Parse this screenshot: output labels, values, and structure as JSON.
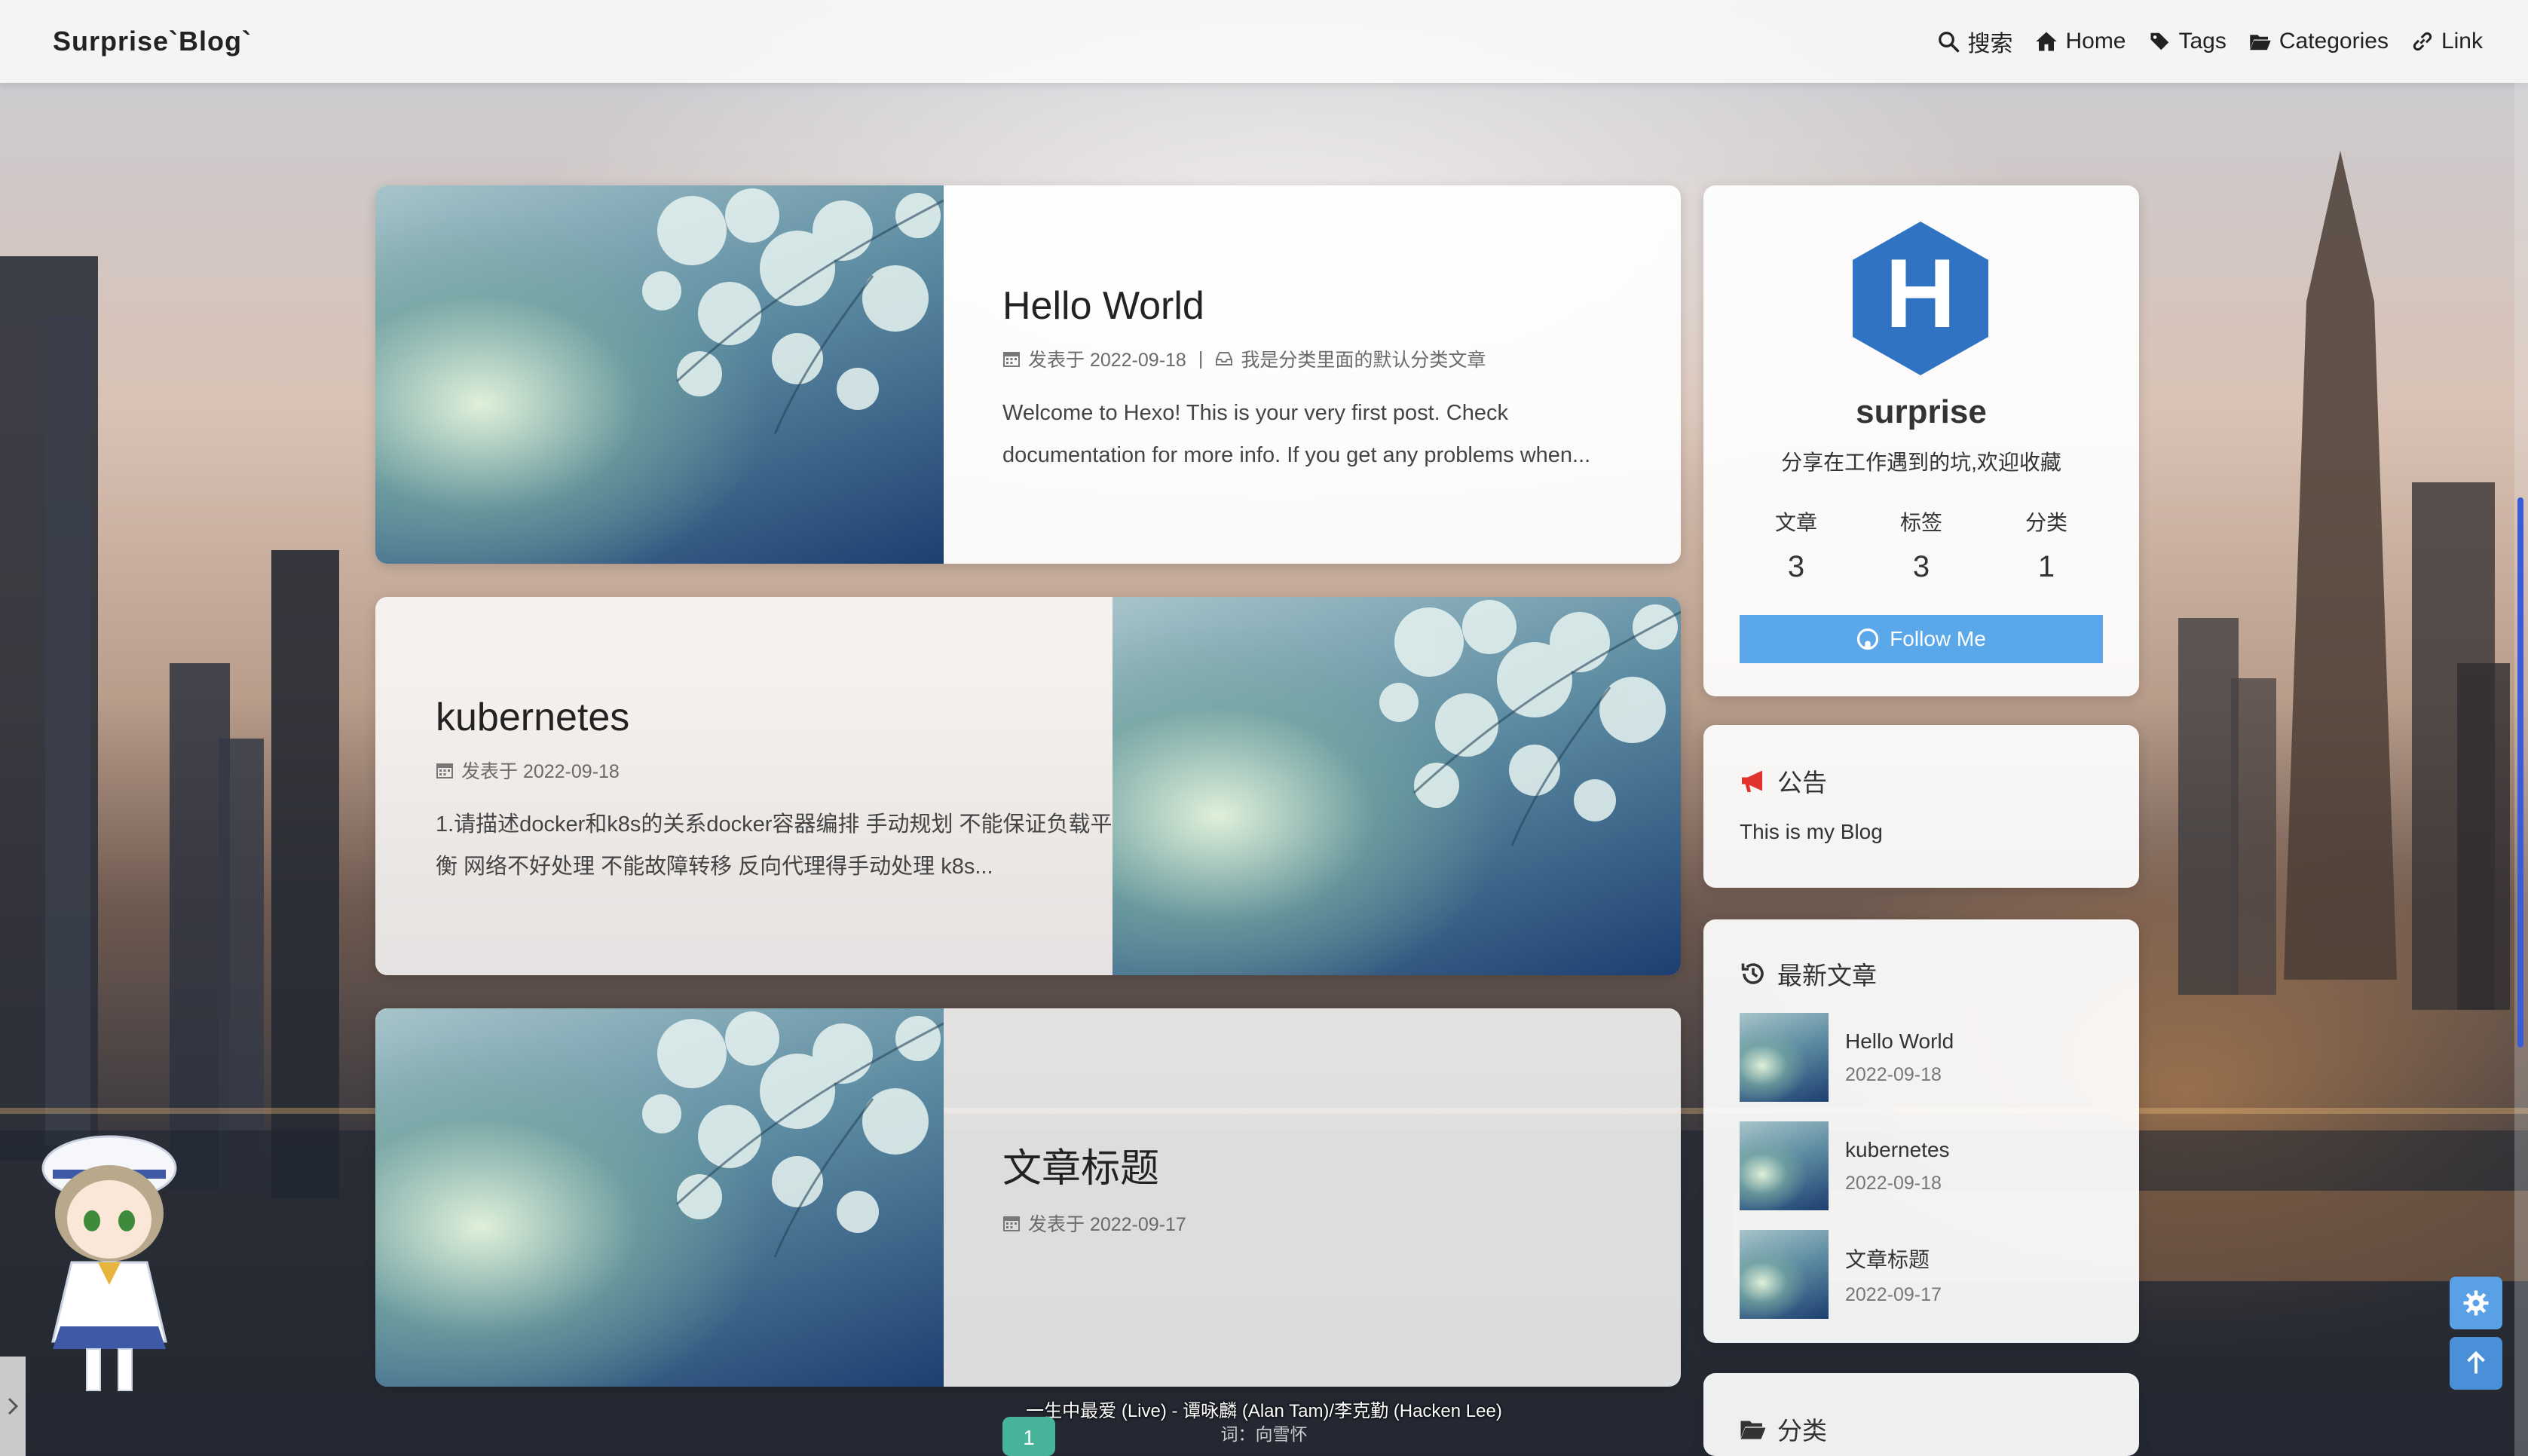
{
  "header": {
    "brand": "Surprise`Blog`",
    "nav": [
      {
        "label": "搜索",
        "icon": "search-icon"
      },
      {
        "label": "Home",
        "icon": "home-icon"
      },
      {
        "label": "Tags",
        "icon": "tags-icon"
      },
      {
        "label": "Categories",
        "icon": "folder-open-icon"
      },
      {
        "label": "Link",
        "icon": "link-icon"
      }
    ]
  },
  "posts": [
    {
      "title": "Hello World",
      "date": "发表于 2022-09-18",
      "category": "我是分类里面的默认分类文章",
      "excerpt": "Welcome to Hexo! This is your very first post. Check documentation for more info. If you get any problems when..."
    },
    {
      "title": "kubernetes",
      "date": "发表于 2022-09-18",
      "excerpt": "1.请描述docker和k8s的关系docker容器编排 手动规划 不能保证负载平衡 网络不好处理 不能故障转移 反向代理得手动处理 k8s..."
    },
    {
      "title": "文章标题",
      "date": "发表于 2022-09-17"
    }
  ],
  "profile": {
    "name": "surprise",
    "description": "分享在工作遇到的坑,欢迎收藏",
    "stats": [
      {
        "label": "文章",
        "value": "3"
      },
      {
        "label": "标签",
        "value": "3"
      },
      {
        "label": "分类",
        "value": "1"
      }
    ],
    "follow_label": "Follow Me",
    "logo_letter": "H"
  },
  "notice": {
    "title": "公告",
    "text": "This is my Blog"
  },
  "recent": {
    "title": "最新文章",
    "items": [
      {
        "title": "Hello World",
        "date": "2022-09-18"
      },
      {
        "title": "kubernetes",
        "date": "2022-09-18"
      },
      {
        "title": "文章标题",
        "date": "2022-09-17"
      }
    ]
  },
  "categories": {
    "title": "分类"
  },
  "pagination": {
    "current": "1"
  },
  "player": {
    "song": "一生中最爱 (Live) - 谭咏麟 (Alan Tam)/李克勤 (Hacken Lee)",
    "lyric": "词：向雪怀"
  },
  "colors": {
    "accent": "#5aa7ea",
    "hexo_blue": "#2f73c2",
    "page_active": "#47b39b",
    "notice_icon": "#e2322d"
  }
}
